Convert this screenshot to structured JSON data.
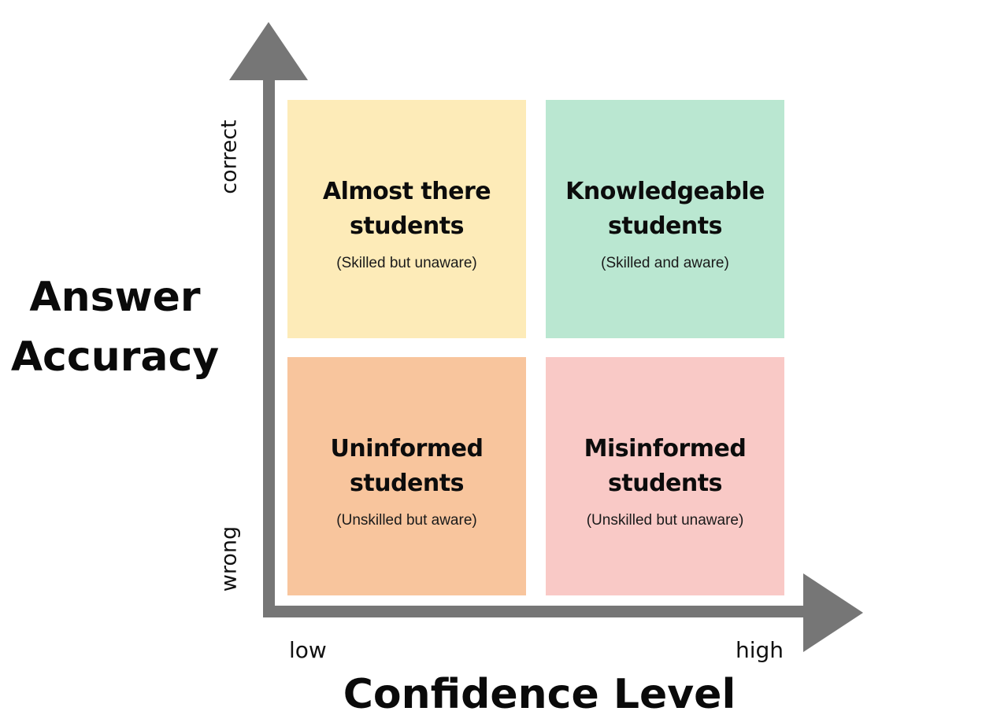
{
  "colors": {
    "axis": "#767676",
    "almost_there": "#fdebb8",
    "knowledgeable": "#bae7d1",
    "uninformed": "#f8c59d",
    "misinformed": "#f9c9c6"
  },
  "y_axis": {
    "title": "Answer\nAccuracy",
    "top_label": "correct",
    "bottom_label": "wrong"
  },
  "x_axis": {
    "title": "Confidence Level",
    "left_label": "low",
    "right_label": "high"
  },
  "quadrants": {
    "top_left": {
      "title": "Almost there\nstudents",
      "subtitle": "(Skilled but unaware)"
    },
    "top_right": {
      "title": "Knowledgeable\nstudents",
      "subtitle": "(Skilled and aware)"
    },
    "bottom_left": {
      "title": "Uninformed\nstudents",
      "subtitle": "(Unskilled but aware)"
    },
    "bottom_right": {
      "title": "Misinformed\nstudents",
      "subtitle": "(Unskilled but unaware)"
    }
  }
}
